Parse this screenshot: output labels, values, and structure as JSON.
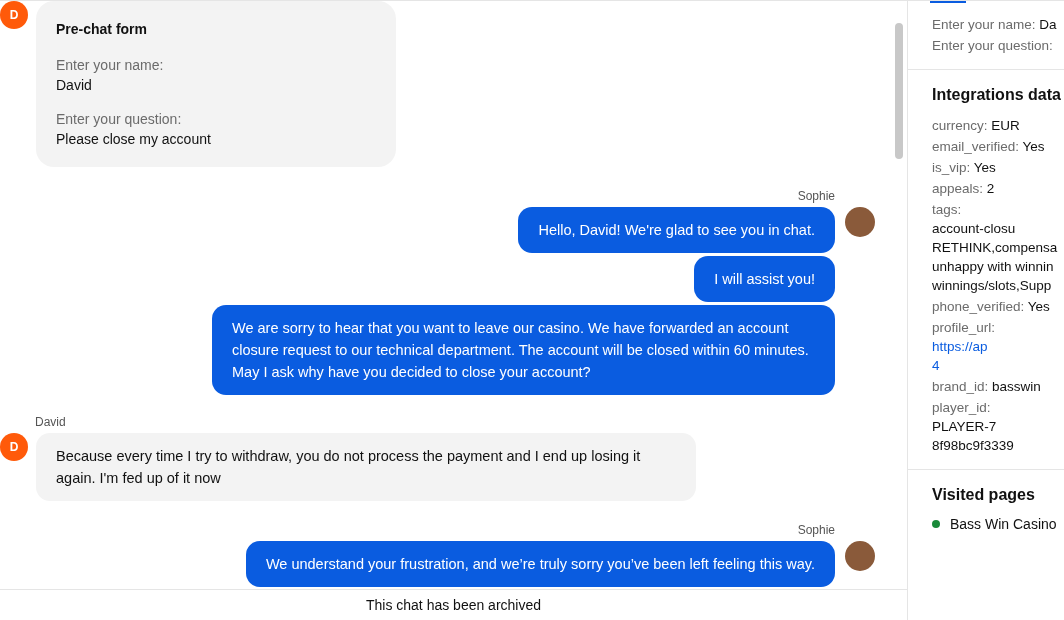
{
  "chat": {
    "groups": [
      {
        "kind": "form",
        "avatar": "D",
        "title": "Pre-chat form",
        "fields": [
          {
            "label": "Enter your name:",
            "value": "David"
          },
          {
            "label": "Enter your question:",
            "value": "Please close my account"
          }
        ]
      },
      {
        "kind": "agent",
        "sender": "Sophie",
        "messages": [
          "Hello, David! We're glad to see you in chat.",
          "I will assist you!",
          "We are sorry to hear that you want to leave our casino. We have forwarded an account closure request to our technical department. The account will be closed within 60 minutes. May I ask why have you decided to close your account?"
        ]
      },
      {
        "kind": "visitor",
        "sender": "David",
        "avatar": "D",
        "messages": [
          "Because every time I try to withdraw, you do not process the payment and I end up losing it again. I'm fed up of it now"
        ]
      },
      {
        "kind": "agent",
        "sender": "Sophie",
        "messages": [
          "We understand your frustration, and we’re truly sorry you’ve been left feeling this way."
        ]
      }
    ],
    "footer": "This chat has been archived"
  },
  "sidebar": {
    "prechat": [
      {
        "label": "Enter your name:",
        "value": "Da"
      },
      {
        "label": "Enter your question:"
      }
    ],
    "integrations": {
      "title": "Integrations data",
      "rows": [
        {
          "label": "currency:",
          "value": "EUR",
          "kind": "text"
        },
        {
          "label": "email_verified:",
          "value": "Yes",
          "kind": "text"
        },
        {
          "label": "is_vip:",
          "value": "Yes",
          "kind": "text"
        },
        {
          "label": "appeals:",
          "value": "2",
          "kind": "text"
        },
        {
          "label": "tags:",
          "value": "account-closu\nRETHINK,compensa\nunhappy with winnin\nwinnings/slots,Supp",
          "kind": "text"
        },
        {
          "label": "phone_verified:",
          "value": "Yes",
          "kind": "text"
        },
        {
          "label": "profile_url:",
          "value": "https://ap\n4",
          "kind": "link"
        },
        {
          "label": "brand_id:",
          "value": "basswin",
          "kind": "text"
        },
        {
          "label": "player_id:",
          "value": "PLAYER-7\n8f98bc9f3339",
          "kind": "text"
        }
      ]
    },
    "visited": {
      "title": "Visited pages",
      "pages": [
        {
          "title": "Bass Win Casino",
          "color": "#1a8a3a"
        }
      ]
    }
  }
}
